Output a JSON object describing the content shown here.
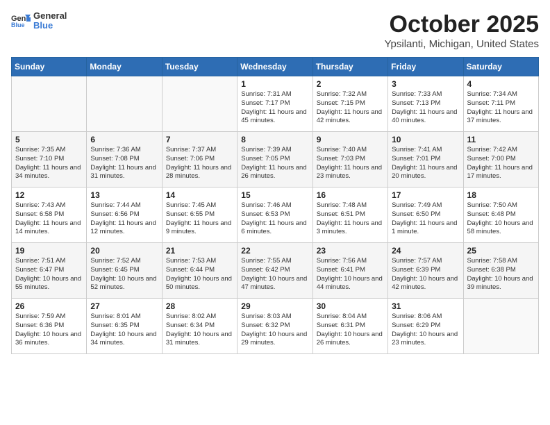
{
  "header": {
    "logo_general": "General",
    "logo_blue": "Blue",
    "month": "October 2025",
    "location": "Ypsilanti, Michigan, United States"
  },
  "weekdays": [
    "Sunday",
    "Monday",
    "Tuesday",
    "Wednesday",
    "Thursday",
    "Friday",
    "Saturday"
  ],
  "weeks": [
    [
      {
        "day": "",
        "sunrise": "",
        "sunset": "",
        "daylight": ""
      },
      {
        "day": "",
        "sunrise": "",
        "sunset": "",
        "daylight": ""
      },
      {
        "day": "",
        "sunrise": "",
        "sunset": "",
        "daylight": ""
      },
      {
        "day": "1",
        "sunrise": "Sunrise: 7:31 AM",
        "sunset": "Sunset: 7:17 PM",
        "daylight": "Daylight: 11 hours and 45 minutes."
      },
      {
        "day": "2",
        "sunrise": "Sunrise: 7:32 AM",
        "sunset": "Sunset: 7:15 PM",
        "daylight": "Daylight: 11 hours and 42 minutes."
      },
      {
        "day": "3",
        "sunrise": "Sunrise: 7:33 AM",
        "sunset": "Sunset: 7:13 PM",
        "daylight": "Daylight: 11 hours and 40 minutes."
      },
      {
        "day": "4",
        "sunrise": "Sunrise: 7:34 AM",
        "sunset": "Sunset: 7:11 PM",
        "daylight": "Daylight: 11 hours and 37 minutes."
      }
    ],
    [
      {
        "day": "5",
        "sunrise": "Sunrise: 7:35 AM",
        "sunset": "Sunset: 7:10 PM",
        "daylight": "Daylight: 11 hours and 34 minutes."
      },
      {
        "day": "6",
        "sunrise": "Sunrise: 7:36 AM",
        "sunset": "Sunset: 7:08 PM",
        "daylight": "Daylight: 11 hours and 31 minutes."
      },
      {
        "day": "7",
        "sunrise": "Sunrise: 7:37 AM",
        "sunset": "Sunset: 7:06 PM",
        "daylight": "Daylight: 11 hours and 28 minutes."
      },
      {
        "day": "8",
        "sunrise": "Sunrise: 7:39 AM",
        "sunset": "Sunset: 7:05 PM",
        "daylight": "Daylight: 11 hours and 26 minutes."
      },
      {
        "day": "9",
        "sunrise": "Sunrise: 7:40 AM",
        "sunset": "Sunset: 7:03 PM",
        "daylight": "Daylight: 11 hours and 23 minutes."
      },
      {
        "day": "10",
        "sunrise": "Sunrise: 7:41 AM",
        "sunset": "Sunset: 7:01 PM",
        "daylight": "Daylight: 11 hours and 20 minutes."
      },
      {
        "day": "11",
        "sunrise": "Sunrise: 7:42 AM",
        "sunset": "Sunset: 7:00 PM",
        "daylight": "Daylight: 11 hours and 17 minutes."
      }
    ],
    [
      {
        "day": "12",
        "sunrise": "Sunrise: 7:43 AM",
        "sunset": "Sunset: 6:58 PM",
        "daylight": "Daylight: 11 hours and 14 minutes."
      },
      {
        "day": "13",
        "sunrise": "Sunrise: 7:44 AM",
        "sunset": "Sunset: 6:56 PM",
        "daylight": "Daylight: 11 hours and 12 minutes."
      },
      {
        "day": "14",
        "sunrise": "Sunrise: 7:45 AM",
        "sunset": "Sunset: 6:55 PM",
        "daylight": "Daylight: 11 hours and 9 minutes."
      },
      {
        "day": "15",
        "sunrise": "Sunrise: 7:46 AM",
        "sunset": "Sunset: 6:53 PM",
        "daylight": "Daylight: 11 hours and 6 minutes."
      },
      {
        "day": "16",
        "sunrise": "Sunrise: 7:48 AM",
        "sunset": "Sunset: 6:51 PM",
        "daylight": "Daylight: 11 hours and 3 minutes."
      },
      {
        "day": "17",
        "sunrise": "Sunrise: 7:49 AM",
        "sunset": "Sunset: 6:50 PM",
        "daylight": "Daylight: 11 hours and 1 minute."
      },
      {
        "day": "18",
        "sunrise": "Sunrise: 7:50 AM",
        "sunset": "Sunset: 6:48 PM",
        "daylight": "Daylight: 10 hours and 58 minutes."
      }
    ],
    [
      {
        "day": "19",
        "sunrise": "Sunrise: 7:51 AM",
        "sunset": "Sunset: 6:47 PM",
        "daylight": "Daylight: 10 hours and 55 minutes."
      },
      {
        "day": "20",
        "sunrise": "Sunrise: 7:52 AM",
        "sunset": "Sunset: 6:45 PM",
        "daylight": "Daylight: 10 hours and 52 minutes."
      },
      {
        "day": "21",
        "sunrise": "Sunrise: 7:53 AM",
        "sunset": "Sunset: 6:44 PM",
        "daylight": "Daylight: 10 hours and 50 minutes."
      },
      {
        "day": "22",
        "sunrise": "Sunrise: 7:55 AM",
        "sunset": "Sunset: 6:42 PM",
        "daylight": "Daylight: 10 hours and 47 minutes."
      },
      {
        "day": "23",
        "sunrise": "Sunrise: 7:56 AM",
        "sunset": "Sunset: 6:41 PM",
        "daylight": "Daylight: 10 hours and 44 minutes."
      },
      {
        "day": "24",
        "sunrise": "Sunrise: 7:57 AM",
        "sunset": "Sunset: 6:39 PM",
        "daylight": "Daylight: 10 hours and 42 minutes."
      },
      {
        "day": "25",
        "sunrise": "Sunrise: 7:58 AM",
        "sunset": "Sunset: 6:38 PM",
        "daylight": "Daylight: 10 hours and 39 minutes."
      }
    ],
    [
      {
        "day": "26",
        "sunrise": "Sunrise: 7:59 AM",
        "sunset": "Sunset: 6:36 PM",
        "daylight": "Daylight: 10 hours and 36 minutes."
      },
      {
        "day": "27",
        "sunrise": "Sunrise: 8:01 AM",
        "sunset": "Sunset: 6:35 PM",
        "daylight": "Daylight: 10 hours and 34 minutes."
      },
      {
        "day": "28",
        "sunrise": "Sunrise: 8:02 AM",
        "sunset": "Sunset: 6:34 PM",
        "daylight": "Daylight: 10 hours and 31 minutes."
      },
      {
        "day": "29",
        "sunrise": "Sunrise: 8:03 AM",
        "sunset": "Sunset: 6:32 PM",
        "daylight": "Daylight: 10 hours and 29 minutes."
      },
      {
        "day": "30",
        "sunrise": "Sunrise: 8:04 AM",
        "sunset": "Sunset: 6:31 PM",
        "daylight": "Daylight: 10 hours and 26 minutes."
      },
      {
        "day": "31",
        "sunrise": "Sunrise: 8:06 AM",
        "sunset": "Sunset: 6:29 PM",
        "daylight": "Daylight: 10 hours and 23 minutes."
      },
      {
        "day": "",
        "sunrise": "",
        "sunset": "",
        "daylight": ""
      }
    ]
  ]
}
